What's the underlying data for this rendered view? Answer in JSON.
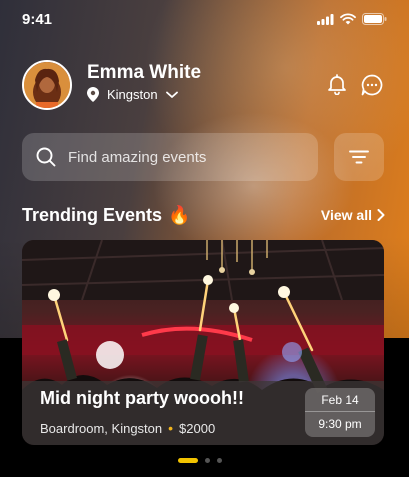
{
  "status": {
    "time": "9:41"
  },
  "user": {
    "name": "Emma White",
    "location": "Kingston"
  },
  "search": {
    "placeholder": "Find amazing events"
  },
  "section": {
    "title": "Trending Events",
    "emoji": "🔥",
    "view_all": "View all"
  },
  "event": {
    "title": "Mid night party woooh!!",
    "venue": "Boardroom, Kingston",
    "price": "$2000",
    "date": "Feb 14",
    "time": "9:30 pm"
  },
  "pager": {
    "pages": 3,
    "active": 1
  },
  "icons": {
    "status": [
      "signal-icon",
      "wifi-icon",
      "battery-icon"
    ],
    "header": [
      "location-pin-icon",
      "chevron-down-icon",
      "bell-icon",
      "chat-icon"
    ],
    "search": [
      "search-icon",
      "filter-icon"
    ],
    "section": [
      "chevron-right-icon"
    ]
  },
  "colors": {
    "accent": "#f2c300",
    "price_dot": "#f2b51c",
    "gradient_end": "#e07f1b"
  }
}
